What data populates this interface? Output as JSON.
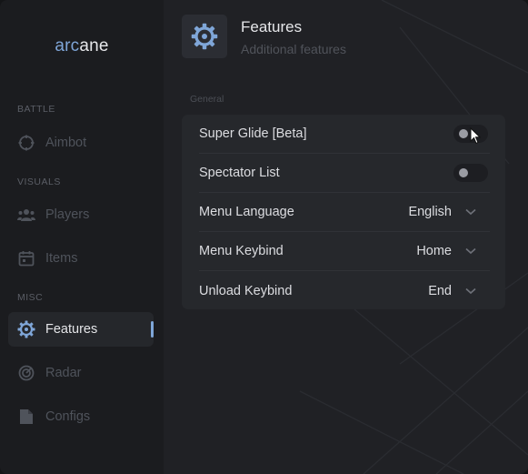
{
  "brand": {
    "part1": "arc",
    "part2": "ane"
  },
  "sidebar": {
    "sections": [
      {
        "label": "BATTLE"
      },
      {
        "label": "VISUALS"
      },
      {
        "label": "MISC"
      }
    ],
    "items": [
      {
        "label": "Aimbot",
        "icon": "crosshair-icon"
      },
      {
        "label": "Players",
        "icon": "users-icon"
      },
      {
        "label": "Items",
        "icon": "calendar-icon"
      },
      {
        "label": "Features",
        "icon": "gear-icon",
        "active": true
      },
      {
        "label": "Radar",
        "icon": "radar-icon"
      },
      {
        "label": "Configs",
        "icon": "file-icon"
      }
    ]
  },
  "header": {
    "title": "Features",
    "subtitle": "Additional features",
    "icon": "gear-icon"
  },
  "group": {
    "label": "General"
  },
  "settings": [
    {
      "label": "Super Glide [Beta]",
      "type": "toggle",
      "enabled": false
    },
    {
      "label": "Spectator List",
      "type": "toggle",
      "enabled": false
    },
    {
      "label": "Menu Language",
      "type": "select",
      "value": "English"
    },
    {
      "label": "Menu Keybind",
      "type": "select",
      "value": "Home"
    },
    {
      "label": "Unload Keybind",
      "type": "select",
      "value": "End"
    }
  ],
  "colors": {
    "accent": "#7fa6d8",
    "background": "#17181b",
    "card": "#26282c"
  }
}
